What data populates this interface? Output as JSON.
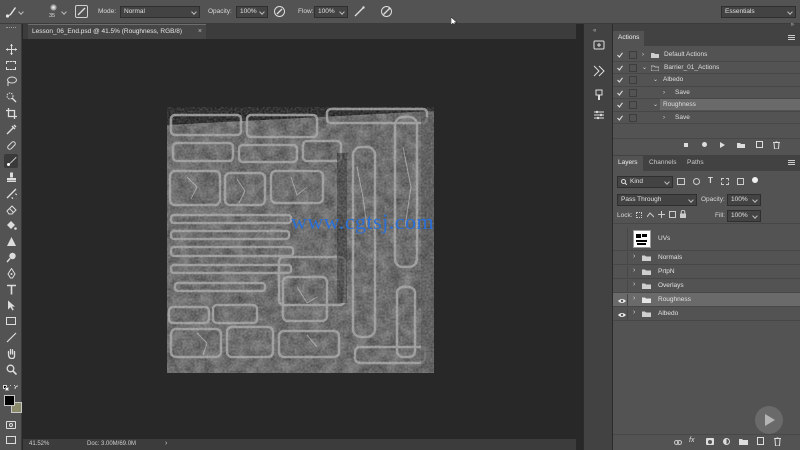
{
  "options_bar": {
    "mode_label": "Mode:",
    "mode_value": "Normal",
    "opacity_label": "Opacity:",
    "opacity_value": "100%",
    "flow_label": "Flow:",
    "flow_value": "100%",
    "brush_size": "35",
    "workspace_value": "Essentials"
  },
  "document": {
    "tab_title": "Lesson_06_End.psd @ 41.5% (Roughness, RGB/8)",
    "watermark": "www.cgtsj.com"
  },
  "status_bar": {
    "zoom": "41.52%",
    "doc_info": "Doc: 3.00M/69.0M"
  },
  "actions_panel": {
    "tab": "Actions",
    "items": [
      {
        "label": "Default Actions",
        "indent": 0,
        "type": "set",
        "expanded": false
      },
      {
        "label": "Barrier_01_Actions",
        "indent": 0,
        "type": "set",
        "expanded": true
      },
      {
        "label": "Albedo",
        "indent": 1,
        "type": "action",
        "expanded": true
      },
      {
        "label": "Save",
        "indent": 2,
        "type": "command",
        "expanded": false
      },
      {
        "label": "Roughness",
        "indent": 1,
        "type": "action",
        "expanded": true
      },
      {
        "label": "Save",
        "indent": 2,
        "type": "command",
        "expanded": false
      }
    ]
  },
  "layers_panel": {
    "tabs": [
      "Layers",
      "Channels",
      "Paths"
    ],
    "filter_value": "Kind",
    "blend_value": "Pass Through",
    "opacity_label": "Opacity:",
    "opacity_value": "100%",
    "lock_label": "Lock:",
    "fill_label": "Fill:",
    "fill_value": "100%",
    "layers": [
      {
        "name": "UVs",
        "type": "pixel",
        "visible": false,
        "selected": false
      },
      {
        "name": "Normals",
        "type": "group",
        "visible": false,
        "selected": false
      },
      {
        "name": "PrtpN",
        "type": "group",
        "visible": false,
        "selected": false
      },
      {
        "name": "Overlays",
        "type": "group",
        "visible": false,
        "selected": false
      },
      {
        "name": "Roughness",
        "type": "group",
        "visible": true,
        "selected": true
      },
      {
        "name": "Albedo",
        "type": "group",
        "visible": true,
        "selected": false
      }
    ]
  },
  "colors": {
    "ui_panel": "#535353",
    "ui_dark": "#282828",
    "watermark": "#2a6fd6",
    "selected_row": "#6a6a6a"
  }
}
